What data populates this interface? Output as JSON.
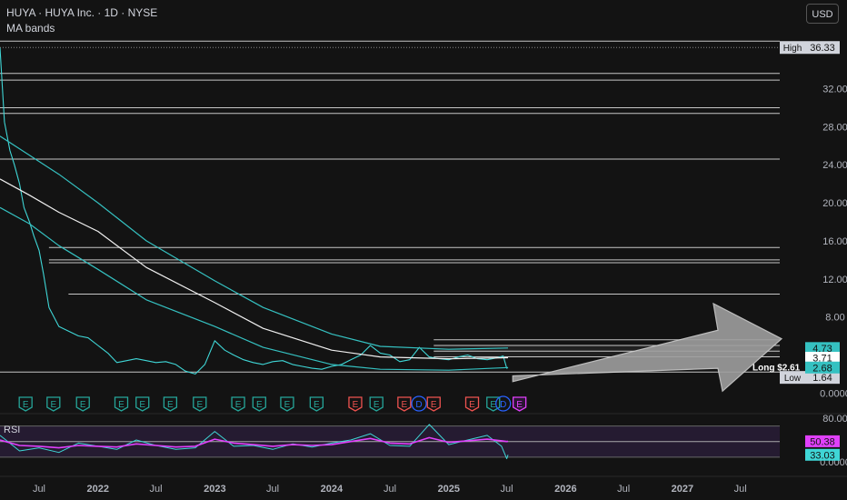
{
  "header": {
    "title": "HUYA · HUYA Inc. · 1D · NYSE",
    "indicator": "MA bands",
    "currency": "USD"
  },
  "colors": {
    "background": "#131313",
    "price": "#3fd6d6",
    "band": "#35c1c1",
    "mid_ma": "#f0f0f0",
    "levels": "#e6e6e6",
    "rsi": "#e040fb",
    "rsi_band": "#2a1e3a",
    "arrow": "#9e9e9e",
    "earnings": "#26a69a",
    "earnings_miss": "#ef5350",
    "dividend": "#2962ff"
  },
  "chart_data": {
    "type": "line",
    "title": "HUYA · HUYA Inc. · 1D · NYSE",
    "x_tick_labels": [
      "Jul",
      "2022",
      "Jul",
      "2023",
      "Jul",
      "2024",
      "Jul",
      "2025",
      "Jul",
      "2026",
      "Jul",
      "2027",
      "Jul"
    ],
    "y_tick_labels": [
      "32.00",
      "28.00",
      "24.00",
      "20.00",
      "16.00",
      "12.00",
      "8.00",
      "0.0000"
    ],
    "y_ticks": [
      32,
      28,
      24,
      20,
      16,
      12,
      8,
      0
    ],
    "ylim": [
      -1.5,
      37.5
    ],
    "x_range": [
      "2021-03",
      "2027-11"
    ],
    "series": [
      {
        "key": "price",
        "x": [
          "2021-03-01",
          "2021-03-15",
          "2021-04-01",
          "2021-04-15",
          "2021-05-01",
          "2021-05-15",
          "2021-06-01",
          "2021-06-15",
          "2021-07-01",
          "2021-07-15",
          "2021-08-01",
          "2021-09-01",
          "2021-10-01",
          "2021-11-01",
          "2021-12-01",
          "2022-01-01",
          "2022-02-01",
          "2022-03-01",
          "2022-04-01",
          "2022-05-01",
          "2022-06-01",
          "2022-07-01",
          "2022-08-01",
          "2022-09-01",
          "2022-10-01",
          "2022-11-01",
          "2022-12-01",
          "2023-01-01",
          "2023-02-01",
          "2023-03-01",
          "2023-04-01",
          "2023-05-01",
          "2023-06-01",
          "2023-07-01",
          "2023-08-01",
          "2023-09-01",
          "2023-10-01",
          "2023-11-01",
          "2023-12-01",
          "2024-01-01",
          "2024-02-01",
          "2024-03-01",
          "2024-04-01",
          "2024-05-01",
          "2024-06-01",
          "2024-07-01",
          "2024-08-01",
          "2024-09-01",
          "2024-10-01",
          "2024-11-01",
          "2024-12-01",
          "2025-01-01",
          "2025-02-01",
          "2025-03-01",
          "2025-04-01",
          "2025-05-01",
          "2025-06-01",
          "2025-06-20",
          "2025-07-01",
          "2025-07-05"
        ],
        "values": [
          36.3,
          28.5,
          25.5,
          24.0,
          22.0,
          19.5,
          18.0,
          16.5,
          15.0,
          12.5,
          9.0,
          7.0,
          6.5,
          6.0,
          5.8,
          5.0,
          4.2,
          3.2,
          3.4,
          3.6,
          3.4,
          3.2,
          3.3,
          3.0,
          2.3,
          2.0,
          3.0,
          5.5,
          4.5,
          4.0,
          3.5,
          3.2,
          3.0,
          3.3,
          3.4,
          3.0,
          2.8,
          2.6,
          2.5,
          2.8,
          3.0,
          3.5,
          4.0,
          5.0,
          4.2,
          4.0,
          3.3,
          3.5,
          4.8,
          3.8,
          3.6,
          3.5,
          3.8,
          4.0,
          3.6,
          3.5,
          3.7,
          3.9,
          2.6,
          2.68
        ]
      },
      {
        "key": "ma_upper",
        "x": [
          "2021-03-01",
          "2021-06-01",
          "2021-09-01",
          "2022-01-01",
          "2022-06-01",
          "2023-01-01",
          "2023-06-01",
          "2024-01-01",
          "2024-06-01",
          "2025-01-01",
          "2025-07-05"
        ],
        "values": [
          27.0,
          25.0,
          23.0,
          20.0,
          16.0,
          11.8,
          9.0,
          6.2,
          4.9,
          4.6,
          4.73
        ]
      },
      {
        "key": "ma_mid",
        "x": [
          "2021-03-01",
          "2021-06-01",
          "2021-09-01",
          "2022-01-01",
          "2022-06-01",
          "2023-01-01",
          "2023-06-01",
          "2024-01-01",
          "2024-06-01",
          "2025-01-01",
          "2025-07-05"
        ],
        "values": [
          22.5,
          20.8,
          19.0,
          17.0,
          13.2,
          9.5,
          6.8,
          4.5,
          3.8,
          3.6,
          3.71
        ]
      },
      {
        "key": "ma_lower",
        "x": [
          "2021-03-01",
          "2021-06-01",
          "2021-09-01",
          "2022-01-01",
          "2022-06-01",
          "2023-01-01",
          "2023-06-01",
          "2024-01-01",
          "2024-06-01",
          "2025-01-01",
          "2025-07-05"
        ],
        "values": [
          19.5,
          17.8,
          15.5,
          13.0,
          9.8,
          7.0,
          4.8,
          3.0,
          2.5,
          2.4,
          2.68
        ]
      }
    ],
    "price_labels": [
      {
        "label": "High",
        "value": "36.33",
        "y": 36.33
      },
      {
        "label": "Low",
        "value": "1.64",
        "y": 1.64
      }
    ],
    "band_value_labels": [
      {
        "value": "4.73",
        "y": 4.73,
        "key": "ma_upper"
      },
      {
        "value": "3.71",
        "y": 3.71,
        "key": "ma_mid"
      },
      {
        "value": "2.68",
        "y": 2.68,
        "key": "ma_lower"
      }
    ],
    "horizontal_levels": [
      {
        "y": 37.0,
        "from": "2021-03-01"
      },
      {
        "y": 33.6,
        "from": "2021-03-01"
      },
      {
        "y": 32.9,
        "from": "2021-03-01"
      },
      {
        "y": 30.0,
        "from": "2021-03-01"
      },
      {
        "y": 29.4,
        "from": "2021-03-01"
      },
      {
        "y": 24.6,
        "from": "2021-03-01"
      },
      {
        "y": 15.3,
        "from": "2021-08-01"
      },
      {
        "y": 14.0,
        "from": "2021-08-01"
      },
      {
        "y": 13.7,
        "from": "2021-08-01"
      },
      {
        "y": 10.4,
        "from": "2021-10-01"
      },
      {
        "y": 5.6,
        "from": "2024-11-15"
      },
      {
        "y": 5.0,
        "from": "2024-11-15"
      },
      {
        "y": 4.4,
        "from": "2024-11-15"
      },
      {
        "y": 3.8,
        "from": "2024-11-15"
      },
      {
        "y": 2.2,
        "from": "2021-03-01"
      }
    ],
    "annotation": "Long $2.61",
    "events": [
      {
        "date": "2021-05-20",
        "label": "E",
        "kind": "earnings"
      },
      {
        "date": "2021-08-15",
        "label": "E",
        "kind": "earnings"
      },
      {
        "date": "2021-11-15",
        "label": "E",
        "kind": "earnings"
      },
      {
        "date": "2022-03-15",
        "label": "E",
        "kind": "earnings"
      },
      {
        "date": "2022-05-20",
        "label": "E",
        "kind": "earnings"
      },
      {
        "date": "2022-08-15",
        "label": "E",
        "kind": "earnings"
      },
      {
        "date": "2022-11-15",
        "label": "E",
        "kind": "earnings"
      },
      {
        "date": "2023-03-15",
        "label": "E",
        "kind": "earnings"
      },
      {
        "date": "2023-05-20",
        "label": "E",
        "kind": "earnings"
      },
      {
        "date": "2023-08-15",
        "label": "E",
        "kind": "earnings"
      },
      {
        "date": "2023-11-15",
        "label": "E",
        "kind": "earnings"
      },
      {
        "date": "2024-03-15",
        "label": "E",
        "kind": "earnings_miss"
      },
      {
        "date": "2024-05-20",
        "label": "E",
        "kind": "earnings"
      },
      {
        "date": "2024-08-15",
        "label": "E",
        "kind": "earnings_miss"
      },
      {
        "date": "2024-09-30",
        "label": "D",
        "kind": "dividend"
      },
      {
        "date": "2024-11-15",
        "label": "E",
        "kind": "earnings_miss"
      },
      {
        "date": "2025-03-15",
        "label": "E",
        "kind": "earnings_miss"
      },
      {
        "date": "2025-05-20",
        "label": "E",
        "kind": "earnings"
      },
      {
        "date": "2025-06-20",
        "label": "D",
        "kind": "dividend"
      },
      {
        "date": "2025-08-10",
        "label": "E",
        "kind": "upcoming"
      }
    ],
    "rsi": {
      "label": "RSI",
      "y_tick_labels": [
        "80.00",
        "0.0000"
      ],
      "y_ticks": [
        80,
        0
      ],
      "ylim": [
        10,
        80
      ],
      "band": [
        30,
        70
      ],
      "mid": 50,
      "current_labels": [
        {
          "value": "50.38",
          "y": 50.38,
          "kind": "ma"
        },
        {
          "value": "33.03",
          "y": 33.03,
          "kind": "rsi"
        }
      ],
      "x": [
        "2021-03-01",
        "2021-05-01",
        "2021-07-01",
        "2021-09-01",
        "2021-11-01",
        "2022-01-01",
        "2022-03-01",
        "2022-05-01",
        "2022-07-01",
        "2022-09-01",
        "2022-11-01",
        "2023-01-01",
        "2023-03-01",
        "2023-05-01",
        "2023-07-01",
        "2023-09-01",
        "2023-11-01",
        "2024-01-01",
        "2024-03-01",
        "2024-05-01",
        "2024-07-01",
        "2024-09-01",
        "2024-11-01",
        "2025-01-01",
        "2025-03-01",
        "2025-05-01",
        "2025-06-15",
        "2025-07-01",
        "2025-07-05"
      ],
      "values": [
        58,
        38,
        42,
        36,
        48,
        44,
        40,
        52,
        45,
        40,
        42,
        63,
        44,
        45,
        40,
        47,
        43,
        48,
        52,
        60,
        45,
        44,
        72,
        46,
        52,
        58,
        44,
        28,
        33.03
      ],
      "ma_values": [
        52,
        45,
        44,
        42,
        45,
        44,
        43,
        47,
        45,
        43,
        44,
        53,
        48,
        46,
        44,
        46,
        45,
        46,
        50,
        54,
        48,
        47,
        55,
        49,
        51,
        53,
        51,
        50,
        50.38
      ]
    }
  }
}
